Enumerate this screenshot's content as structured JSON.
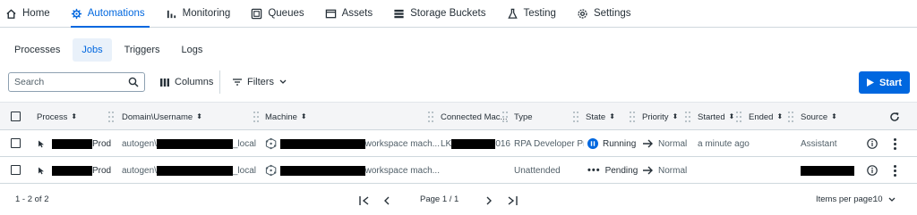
{
  "nav": {
    "home": "Home",
    "automations": "Automations",
    "monitoring": "Monitoring",
    "queues": "Queues",
    "assets": "Assets",
    "storage_buckets": "Storage Buckets",
    "testing": "Testing",
    "settings": "Settings"
  },
  "subtabs": {
    "processes": "Processes",
    "jobs": "Jobs",
    "triggers": "Triggers",
    "logs": "Logs"
  },
  "toolbar": {
    "search_placeholder": "Search",
    "columns": "Columns",
    "filters": "Filters",
    "start": "Start"
  },
  "columns": {
    "process": "Process",
    "domain_username": "Domain\\Username",
    "machine": "Machine",
    "connected_machine": "Connected Mac...",
    "type": "Type",
    "state": "State",
    "priority": "Priority",
    "started": "Started",
    "ended": "Ended",
    "source": "Source"
  },
  "rows": [
    {
      "process_suffix": "Prod",
      "domain_prefix": "autogen\\",
      "domain_suffix": "_local",
      "machine_suffix": "workspace mach...",
      "connected_prefix": "LK",
      "connected_suffix": "016",
      "type": "RPA Developer Pro",
      "state": "Running",
      "priority": "Normal",
      "started": "a minute ago",
      "ended": "",
      "source": "Assistant"
    },
    {
      "process_suffix": "Prod",
      "domain_prefix": "autogen\\",
      "domain_suffix": "_local",
      "machine_suffix": "workspace mach...",
      "connected_prefix": "",
      "connected_suffix": "",
      "type": "Unattended",
      "state": "Pending",
      "priority": "Normal",
      "started": "",
      "ended": "",
      "source": ""
    }
  ],
  "footer": {
    "range": "1 - 2 of 2",
    "page": "Page 1 / 1",
    "items_per_page_label": "Items per page:",
    "items_per_page_value": "10"
  },
  "colors": {
    "accent": "#0067df",
    "text": "#273139",
    "muted": "#526069"
  }
}
